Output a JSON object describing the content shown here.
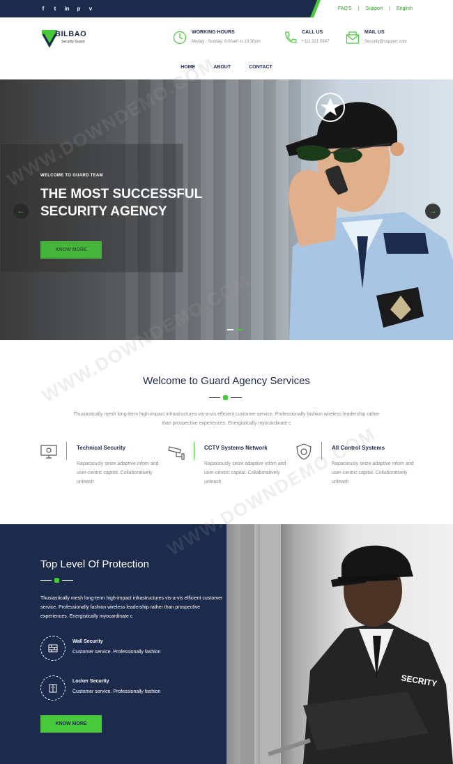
{
  "topbar": {
    "social_icons": [
      "facebook-icon",
      "twitter-icon",
      "linkedin-icon",
      "pinterest-icon",
      "vimeo-icon"
    ],
    "social_glyphs": [
      "f",
      "t",
      "in",
      "p",
      "v"
    ],
    "links": [
      "FAQ'S",
      "Support",
      "English"
    ],
    "separator": "|"
  },
  "header": {
    "logo": {
      "name": "BILBAO",
      "sub": "Security Guard"
    },
    "info": [
      {
        "icon": "clock-icon",
        "title": "WORKING HOURS",
        "text": "Moday - Sunday: 8.00am to 10.30pm"
      },
      {
        "icon": "phone-icon",
        "title": "CALL US",
        "text": "+111 321 5547"
      },
      {
        "icon": "mail-icon",
        "title": "MAIL US",
        "text": "Security@support.com"
      }
    ],
    "nav": [
      "HOME",
      "ABOUT",
      "CONTACT"
    ]
  },
  "hero": {
    "eyebrow": "WELCOME TO GUARD TEAM",
    "title_line1": "THE MOST SUCCESSFUL",
    "title_line2": "SECURITY AGENCY",
    "button": "KNOW MORE",
    "prev": "←",
    "next": "→",
    "slides": 2,
    "active_slide": 2
  },
  "welcome": {
    "title": "Welcome to Guard Agency Services",
    "text": "Thusiastically mesh long-term high-impact infrastructures vis-a-vis efficient customer service. Professionally fashion wireless leadership rather than prospective experiences. Energistically myocardinate c",
    "services": [
      {
        "icon": "monitor-icon",
        "title": "Technical Security",
        "text": "Rapaciously seize adaptive infom and user-centric capital. Collaboratively unleash"
      },
      {
        "icon": "cctv-icon",
        "title": "CCTV Systems Network",
        "text": "Rapaciously seize adaptive infom and user-centric capital. Collaboratively unleash"
      },
      {
        "icon": "shield-check-icon",
        "title": "All Control Systems",
        "text": "Rapaciously seize adaptive infom and user-centric capital. Collaboratively unleash"
      }
    ]
  },
  "protection": {
    "title": "Top Level Of Protection",
    "text": "Thusiastically mesh long-term high-impact infrastructures vis-a-vis efficient customer service. Professionally fashion wireless leadership rather than prospective experiences. Energistically myocardinate c",
    "features": [
      {
        "icon": "wall-icon",
        "title": "Wall Security",
        "text": "Customer service. Professionally fashion"
      },
      {
        "icon": "locker-icon",
        "title": "Locker Security",
        "text": "Customer service. Professionally fashion"
      }
    ],
    "button": "KNOW MORE"
  },
  "colors": {
    "navy": "#1c2a4c",
    "green": "#47c93a"
  }
}
